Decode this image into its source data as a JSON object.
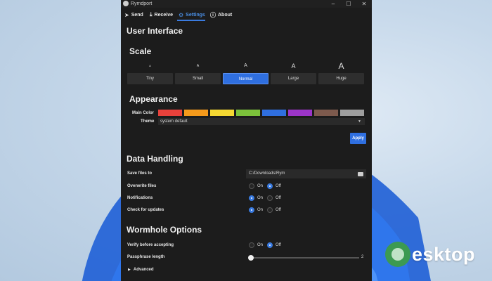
{
  "window": {
    "title": "Rymdport",
    "controls": [
      "–",
      "☐",
      "✕"
    ]
  },
  "tabs": [
    {
      "label": "Send",
      "icon": "send-icon"
    },
    {
      "label": "Receive",
      "icon": "download-icon"
    },
    {
      "label": "Settings",
      "icon": "gear-icon",
      "active": true
    },
    {
      "label": "About",
      "icon": "info-icon"
    }
  ],
  "settings": {
    "user_interface": {
      "heading": "User Interface",
      "scale": {
        "heading": "Scale",
        "glyph": "A",
        "options": [
          "Tiny",
          "Small",
          "Normal",
          "Large",
          "Huge"
        ],
        "selected": "Normal"
      },
      "appearance": {
        "heading": "Appearance",
        "main_color_label": "Main Color",
        "colors": [
          "#e8413b",
          "#f59a1b",
          "#f5d832",
          "#7cc23b",
          "#2f6fe0",
          "#9c35c9",
          "#7d5a4d",
          "#9e9e9e"
        ],
        "theme_label": "Theme",
        "theme_value": "system default",
        "apply_label": "Apply"
      }
    },
    "data_handling": {
      "heading": "Data Handling",
      "save_files_label": "Save files to",
      "save_files_path": "C:/Downloads/Rym",
      "on_label": "On",
      "off_label": "Off",
      "rows": [
        {
          "label": "Overwrite files",
          "value": "Off"
        },
        {
          "label": "Notifications",
          "value": "On"
        },
        {
          "label": "Check for updates",
          "value": "On"
        }
      ]
    },
    "wormhole": {
      "heading": "Wormhole Options",
      "verify_label": "Verify before accepting",
      "verify_value": "Off",
      "passphrase_label": "Passphrase length",
      "passphrase_value": "2",
      "advanced_label": "Advanced"
    }
  },
  "watermark": {
    "text": "esktop"
  },
  "colors": {
    "accent": "#2f6fe0",
    "window_bg": "#1c1c1c",
    "desktop_bg": "#c6d8ea"
  }
}
